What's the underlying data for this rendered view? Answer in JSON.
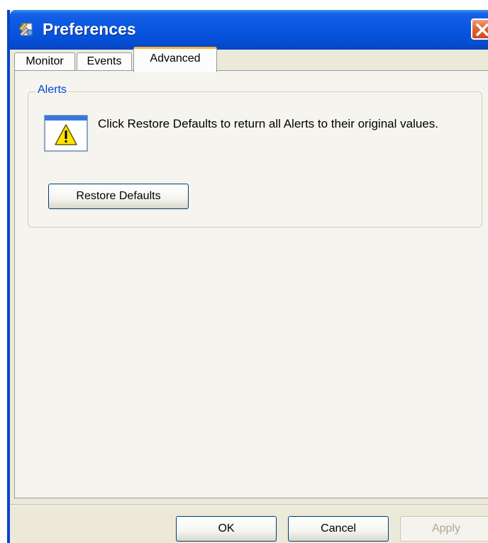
{
  "window": {
    "title": "Preferences",
    "icon": "preferences-icon",
    "close_icon": "close-icon"
  },
  "tabs": [
    {
      "label": "Monitor",
      "selected": false
    },
    {
      "label": "Events",
      "selected": false
    },
    {
      "label": "Advanced",
      "selected": true
    }
  ],
  "alerts": {
    "group_title": "Alerts",
    "icon": "warning-icon",
    "message": "Click Restore Defaults to return all Alerts to their original values.",
    "restore_label": "Restore Defaults"
  },
  "footer": {
    "ok_label": "OK",
    "cancel_label": "Cancel",
    "apply_label": "Apply",
    "apply_enabled": false
  },
  "colors": {
    "titlebar": "#0a56e0",
    "active_tab_accent": "#f7b53b",
    "group_title": "#0046d5",
    "close_button": "#e26a3a",
    "warning": "#ffe600"
  }
}
